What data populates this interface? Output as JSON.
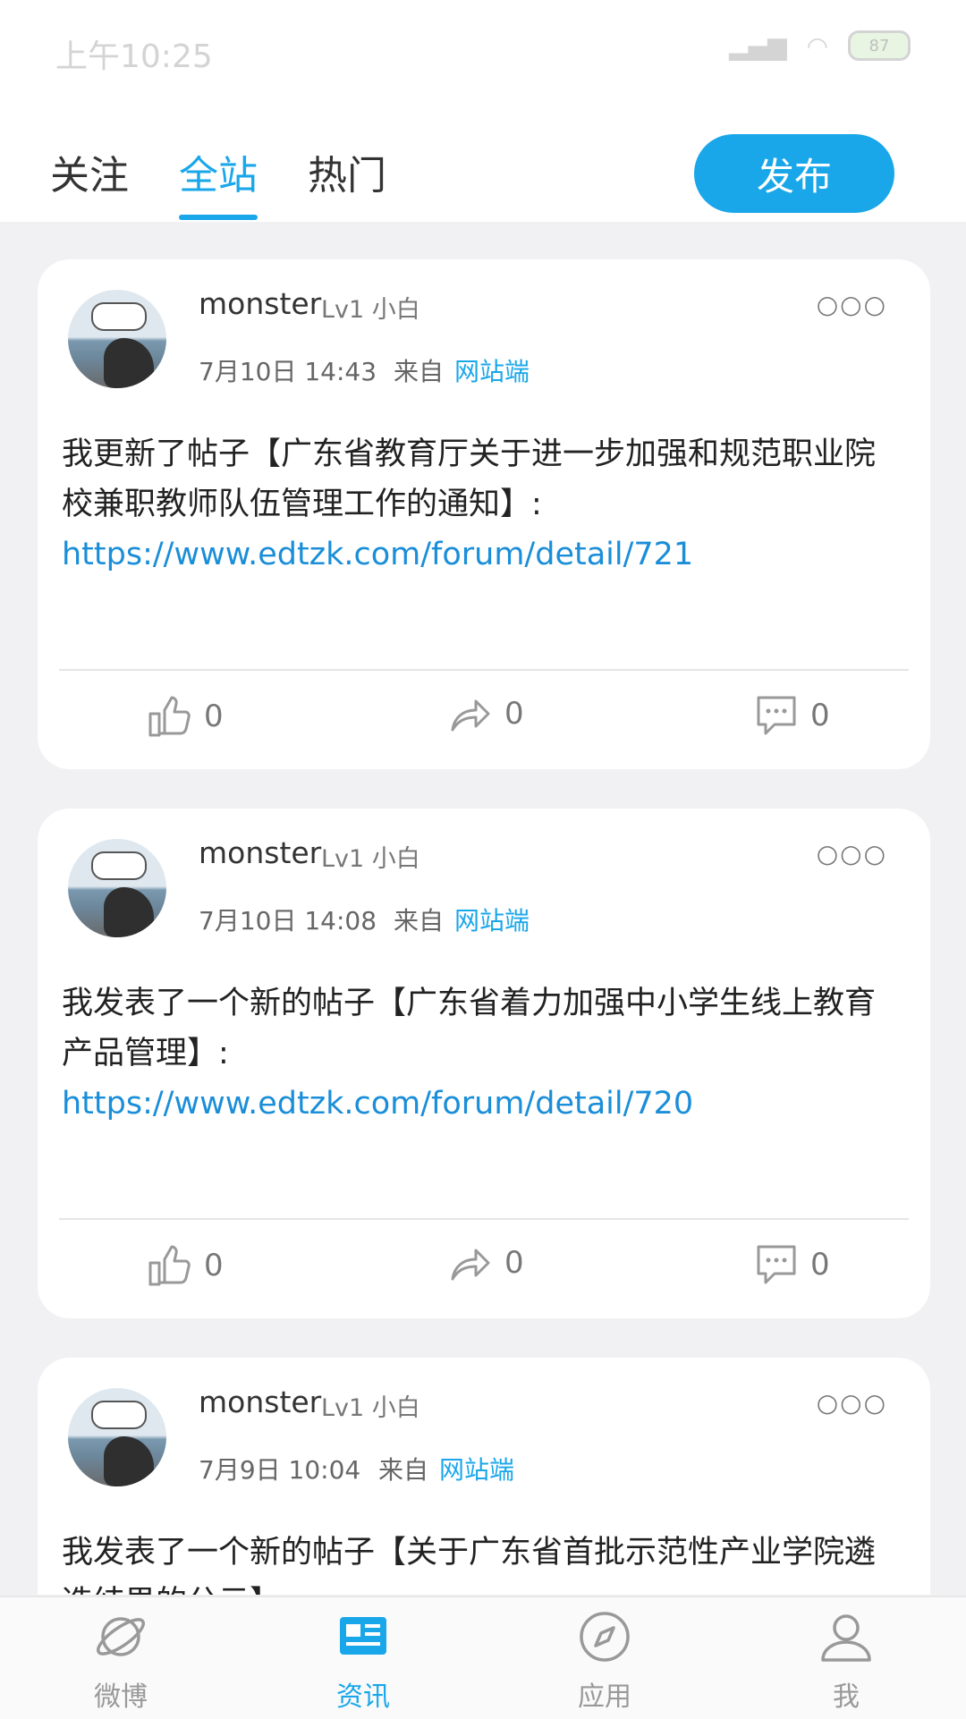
{
  "statusbar": {
    "time": "上午10:25",
    "battery": "87"
  },
  "tabs": [
    {
      "label": "关注"
    },
    {
      "label": "全站"
    },
    {
      "label": "热门"
    }
  ],
  "publish_label": "发布",
  "colors": {
    "accent": "#1aa7ea",
    "link": "#1a8ed8"
  },
  "posts": [
    {
      "username": "monster",
      "level": "Lv1 小白",
      "date": "7月10日 14:43",
      "source_label": "来自",
      "source": "网站端",
      "text": "我更新了帖子【广东省教育厅关于进一步加强和规范职业院校兼职教师队伍管理工作的通知】:",
      "link": "https://www.edtzk.com/forum/detail/721",
      "likes": "0",
      "shares": "0",
      "comments": "0"
    },
    {
      "username": "monster",
      "level": "Lv1 小白",
      "date": "7月10日 14:08",
      "source_label": "来自",
      "source": "网站端",
      "text": "我发表了一个新的帖子【广东省着力加强中小学生线上教育产品管理】:",
      "link": "https://www.edtzk.com/forum/detail/720",
      "likes": "0",
      "shares": "0",
      "comments": "0"
    },
    {
      "username": "monster",
      "level": "Lv1 小白",
      "date": "7月9日 10:04",
      "source_label": "来自",
      "source": "网站端",
      "text": "我发表了一个新的帖子【关于广东省首批示范性产业学院遴选结果的公示】"
    }
  ],
  "bottom_nav": [
    {
      "label": "微博",
      "icon": "planet-icon"
    },
    {
      "label": "资讯",
      "icon": "news-icon"
    },
    {
      "label": "应用",
      "icon": "compass-icon"
    },
    {
      "label": "我",
      "icon": "user-icon"
    }
  ]
}
